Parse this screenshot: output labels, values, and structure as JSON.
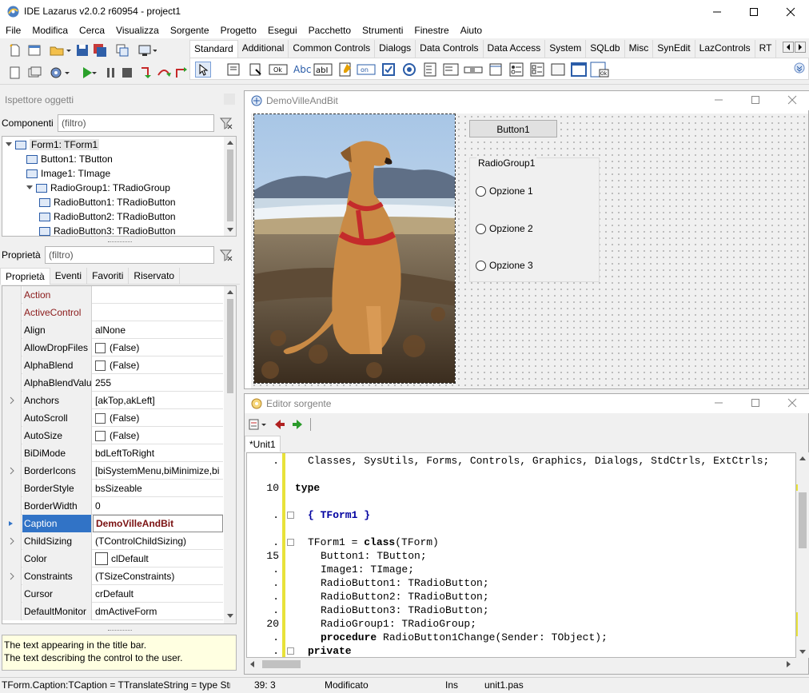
{
  "app": {
    "title": "IDE Lazarus v2.0.2 r60954 - project1"
  },
  "menu": [
    "File",
    "Modifica",
    "Cerca",
    "Visualizza",
    "Sorgente",
    "Progetto",
    "Esegui",
    "Pacchetto",
    "Strumenti",
    "Finestre",
    "Aiuto"
  ],
  "palette": {
    "tabs": [
      "Standard",
      "Additional",
      "Common Controls",
      "Dialogs",
      "Data Controls",
      "Data Access",
      "System",
      "SQLdb",
      "Misc",
      "SynEdit",
      "LazControls",
      "RT"
    ],
    "active": "Standard",
    "comp_labels": {
      "ok": "Ok",
      "abc": "Abc",
      "abi": "abI",
      "on": "on",
      "ok2": "Ok"
    }
  },
  "inspector": {
    "title": "Ispettore oggetti",
    "components_label": "Componenti",
    "filter_placeholder": "(filtro)",
    "tree": [
      {
        "text": "Form1: TForm1",
        "level": 0,
        "selected": true
      },
      {
        "text": "Button1: TButton",
        "level": 1
      },
      {
        "text": "Image1: TImage",
        "level": 1
      },
      {
        "text": "RadioGroup1: TRadioGroup",
        "level": 1
      },
      {
        "text": "RadioButton1: TRadioButton",
        "level": 2
      },
      {
        "text": "RadioButton2: TRadioButton",
        "level": 2
      },
      {
        "text": "RadioButton3: TRadioButton",
        "level": 2
      }
    ],
    "props_label": "Proprietà",
    "tabs": [
      "Proprietà",
      "Eventi",
      "Favoriti",
      "Riservato"
    ],
    "properties": [
      {
        "name": "Action",
        "value": "",
        "red": true
      },
      {
        "name": "ActiveControl",
        "value": "",
        "red": true
      },
      {
        "name": "Align",
        "value": "alNone"
      },
      {
        "name": "AllowDropFiles",
        "value": "(False)",
        "check": true
      },
      {
        "name": "AlphaBlend",
        "value": "(False)",
        "check": true
      },
      {
        "name": "AlphaBlendValu",
        "value": "255"
      },
      {
        "name": "Anchors",
        "value": "[akTop,akLeft]",
        "expand": true
      },
      {
        "name": "AutoScroll",
        "value": "(False)",
        "check": true
      },
      {
        "name": "AutoSize",
        "value": "(False)",
        "check": true
      },
      {
        "name": "BiDiMode",
        "value": "bdLeftToRight"
      },
      {
        "name": "BorderIcons",
        "value": "[biSystemMenu,biMinimize,bi",
        "expand": true
      },
      {
        "name": "BorderStyle",
        "value": "bsSizeable"
      },
      {
        "name": "BorderWidth",
        "value": "0"
      },
      {
        "name": "Caption",
        "value": "DemoVilleAndBit",
        "selected": true
      },
      {
        "name": "ChildSizing",
        "value": "(TControlChildSizing)",
        "expand": true
      },
      {
        "name": "Color",
        "value": "clDefault",
        "color": true
      },
      {
        "name": "Constraints",
        "value": "(TSizeConstraints)",
        "expand": true
      },
      {
        "name": "Cursor",
        "value": "crDefault"
      },
      {
        "name": "DefaultMonitor",
        "value": "dmActiveForm"
      }
    ],
    "hint_lines": [
      "The text appearing in the title bar.",
      "The text describing the control to the user."
    ]
  },
  "form": {
    "title": "DemoVilleAndBit",
    "button": "Button1",
    "radiogroup": "RadioGroup1",
    "options": [
      "Opzione 1",
      "Opzione 2",
      "Opzione 3"
    ]
  },
  "editor": {
    "title": "Editor sorgente",
    "tab": "*Unit1",
    "lines": [
      {
        "num": ".",
        "fold": false,
        "html": "Classes, SysUtils, Forms, Controls, Graphics, Dialogs, StdCtrls, ExtCtrls;",
        "indent": 1
      },
      {
        "num": "",
        "fold": false,
        "html": "",
        "indent": 0
      },
      {
        "num": "10",
        "fold": false,
        "html": "<span class=\"kw\">type</span>",
        "indent": 0
      },
      {
        "num": "",
        "fold": false,
        "html": "",
        "indent": 0
      },
      {
        "num": ".",
        "fold": true,
        "html": "<span class=\"cm\">{ TForm1 }</span>",
        "indent": 1
      },
      {
        "num": "",
        "fold": false,
        "html": "",
        "indent": 0
      },
      {
        "num": ".",
        "fold": true,
        "html": "TForm1 = <span class=\"kw\">class</span>(TForm)",
        "indent": 1
      },
      {
        "num": "15",
        "fold": false,
        "html": "Button1: TButton;",
        "indent": 2
      },
      {
        "num": ".",
        "fold": false,
        "html": "Image1: TImage;",
        "indent": 2
      },
      {
        "num": ".",
        "fold": false,
        "html": "RadioButton1: TRadioButton;",
        "indent": 2
      },
      {
        "num": ".",
        "fold": false,
        "html": "RadioButton2: TRadioButton;",
        "indent": 2
      },
      {
        "num": ".",
        "fold": false,
        "html": "RadioButton3: TRadioButton;",
        "indent": 2
      },
      {
        "num": "20",
        "fold": false,
        "html": "RadioGroup1: TRadioGroup;",
        "indent": 2
      },
      {
        "num": ".",
        "fold": false,
        "html": "<span class=\"kw\">procedure</span> RadioButton1Change(Sender: TObject);",
        "indent": 2
      },
      {
        "num": ".",
        "fold": true,
        "html": "<span class=\"kw\">private</span>",
        "indent": 1
      }
    ]
  },
  "status": {
    "left": "TForm.Caption:TCaption = TTranslateString = type Str",
    "pos": "39: 3",
    "modified": "Modificato",
    "mode": "Ins",
    "file": "unit1.pas"
  },
  "colors": {
    "accent": "#3173c6",
    "hint_bg": "#ffffe1",
    "changebar": "#e8e23a"
  }
}
